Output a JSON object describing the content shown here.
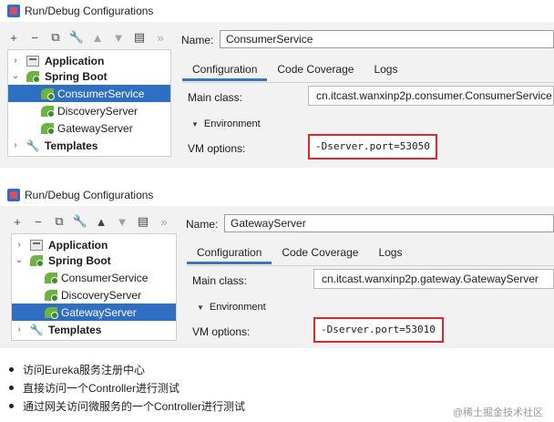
{
  "dialogs": [
    {
      "title": "Run/Debug Configurations",
      "name_label": "Name:",
      "name_value": "ConsumerService",
      "tree": {
        "application": "Application",
        "spring_boot": "Spring Boot",
        "items": [
          "ConsumerService",
          "DiscoveryServer",
          "GatewayServer"
        ],
        "selected": "ConsumerService",
        "templates": "Templates"
      },
      "tabs": [
        "Configuration",
        "Code Coverage",
        "Logs"
      ],
      "active_tab": "Configuration",
      "main_class_label": "Main class:",
      "main_class_value": "cn.itcast.wanxinp2p.consumer.ConsumerService",
      "environment_label": "Environment",
      "vm_options_label": "VM options:",
      "vm_options_value": "-Dserver.port=53050"
    },
    {
      "title": "Run/Debug Configurations",
      "name_label": "Name:",
      "name_value": "GatewayServer",
      "tree": {
        "application": "Application",
        "spring_boot": "Spring Boot",
        "items": [
          "ConsumerService",
          "DiscoveryServer",
          "GatewayServer"
        ],
        "selected": "GatewayServer",
        "templates": "Templates"
      },
      "tabs": [
        "Configuration",
        "Code Coverage",
        "Logs"
      ],
      "active_tab": "Configuration",
      "main_class_label": "Main class:",
      "main_class_value": "cn.itcast.wanxinp2p.gateway.GatewayServer",
      "environment_label": "Environment",
      "vm_options_label": "VM options:",
      "vm_options_value": "-Dserver.port=53010"
    }
  ],
  "toolbar_icons": [
    "add-icon",
    "remove-icon",
    "copy-icon",
    "wrench-icon",
    "move-up-icon",
    "move-down-icon",
    "folder-icon",
    "more-icon"
  ],
  "notes": [
    "访问Eureka服务注册中心",
    "直接访问一个Controller进行测试",
    "通过网关访问微服务的一个Controller进行测试"
  ],
  "watermark": "@稀土掘金技术社区",
  "colors": {
    "selection": "#2f6fc2",
    "highlight_box": "#e0262b",
    "active_tab_underline": "#3b73c8",
    "spring_green": "#6cb33f"
  }
}
